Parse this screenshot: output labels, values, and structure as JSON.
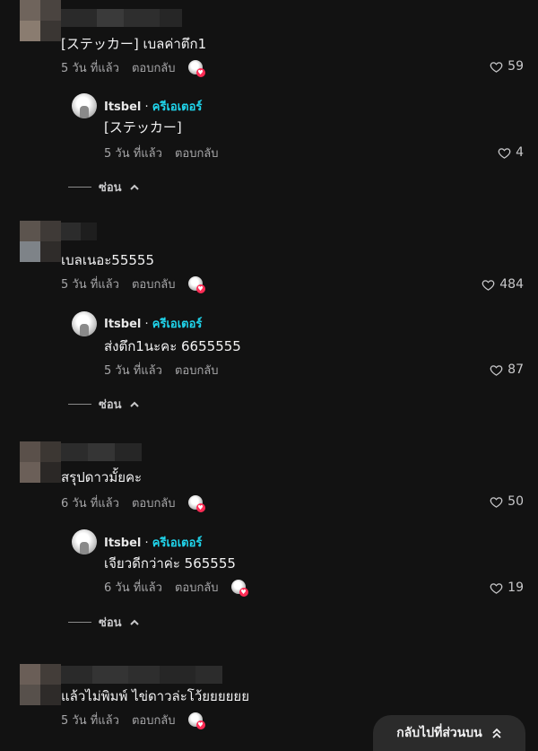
{
  "comments": [
    {
      "text": "[ステッカー] เบลค่าตึก1",
      "time": "5 วัน ที่แล้ว",
      "reply_label": "ตอบกลับ",
      "likes": "59",
      "creator_reply": {
        "username": "Itsbel",
        "separator": "·",
        "badge": "ครีเอเตอร์",
        "text": "[ステッカー]",
        "time": "5 วัน ที่แล้ว",
        "reply_label": "ตอบกลับ",
        "likes": "4"
      },
      "hide_label": "ซ่อน"
    },
    {
      "text": "เบลเนอะ55555",
      "time": "5 วัน ที่แล้ว",
      "reply_label": "ตอบกลับ",
      "likes": "484",
      "creator_reply": {
        "username": "Itsbel",
        "separator": "·",
        "badge": "ครีเอเตอร์",
        "text": "ส่งตึก1นะคะ 6655555",
        "time": "5 วัน ที่แล้ว",
        "reply_label": "ตอบกลับ",
        "likes": "87"
      },
      "hide_label": "ซ่อน"
    },
    {
      "text": "สรุปดาวมั้ยคะ",
      "time": "6 วัน ที่แล้ว",
      "reply_label": "ตอบกลับ",
      "likes": "50",
      "creator_reply": {
        "username": "Itsbel",
        "separator": "·",
        "badge": "ครีเอเตอร์",
        "text": "เจียวดีกว่าค่ะ 565555",
        "time": "6 วัน ที่แล้ว",
        "reply_label": "ตอบกลับ",
        "likes": "19"
      },
      "hide_label": "ซ่อน"
    },
    {
      "text": "แล้วไม่พิมพ์ ไข่ดาวล่ะโว้ยยยยยย",
      "time": "5 วัน ที่แล้ว",
      "reply_label": "ตอบกลับ"
    }
  ],
  "back_to_top": "กลับไปที่ส่วนบน",
  "colors": {
    "background": "#121212",
    "creator_badge": "#20d5ec",
    "liked_heart": "#fe2c55"
  },
  "icons": [
    "heart-outline-icon",
    "chevron-up-icon",
    "double-chevron-up-icon"
  ]
}
